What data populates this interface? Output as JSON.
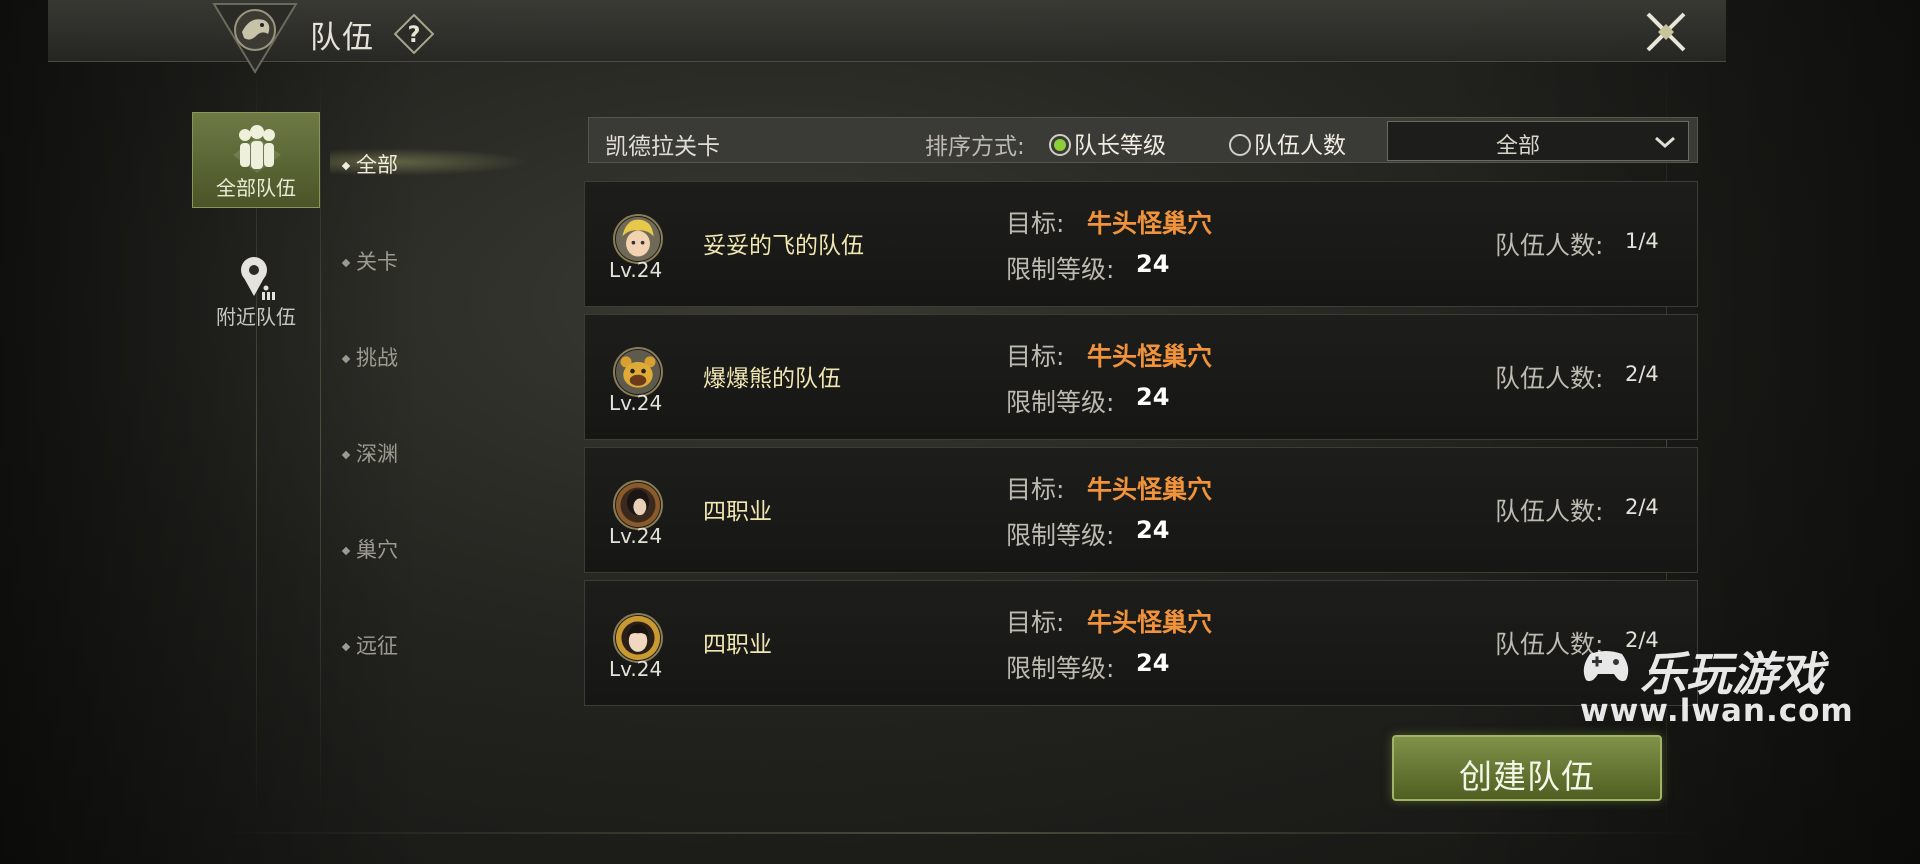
{
  "header": {
    "title": "队伍",
    "help_glyph": "?"
  },
  "categories": [
    {
      "label": "全部队伍",
      "icon": "group-icon",
      "active": true
    },
    {
      "label": "附近队伍",
      "icon": "nearby-location-icon",
      "active": false
    }
  ],
  "sub_filters": [
    "全部",
    "关卡",
    "挑战",
    "深渊",
    "巢穴",
    "远征"
  ],
  "filter_bar": {
    "stage_name": "凯德拉关卡",
    "sort_label": "排序方式:",
    "sort_options": [
      {
        "label": "队长等级",
        "selected": true
      },
      {
        "label": "队伍人数",
        "selected": false
      }
    ],
    "dropdown_value": "全部"
  },
  "row_labels": {
    "target": "目标:",
    "level_limit": "限制等级:",
    "member_count": "队伍人数:"
  },
  "teams": [
    {
      "level": "Lv.24",
      "name": "妥妥的飞的队伍",
      "target": "牛头怪巢穴",
      "level_limit": "24",
      "members": "1/4",
      "avatar": "blond-hero-avatar"
    },
    {
      "level": "Lv.24",
      "name": "爆爆熊的队伍",
      "target": "牛头怪巢穴",
      "level_limit": "24",
      "members": "2/4",
      "avatar": "bear-mascot-avatar"
    },
    {
      "level": "Lv.24",
      "name": "四职业",
      "target": "牛头怪巢穴",
      "level_limit": "24",
      "members": "2/4",
      "avatar": "dark-hair-avatar"
    },
    {
      "level": "Lv.24",
      "name": "四职业",
      "target": "牛头怪巢穴",
      "level_limit": "24",
      "members": "2/4",
      "avatar": "gold-frame-girl-avatar"
    }
  ],
  "create_button": "创建队伍",
  "watermark": {
    "logo": "乐玩游戏",
    "url": "www.lwan.com"
  },
  "colors": {
    "accent_green": "#6d7a45",
    "target_orange": "#f0933a",
    "radio_on": "#8ccf3a"
  }
}
